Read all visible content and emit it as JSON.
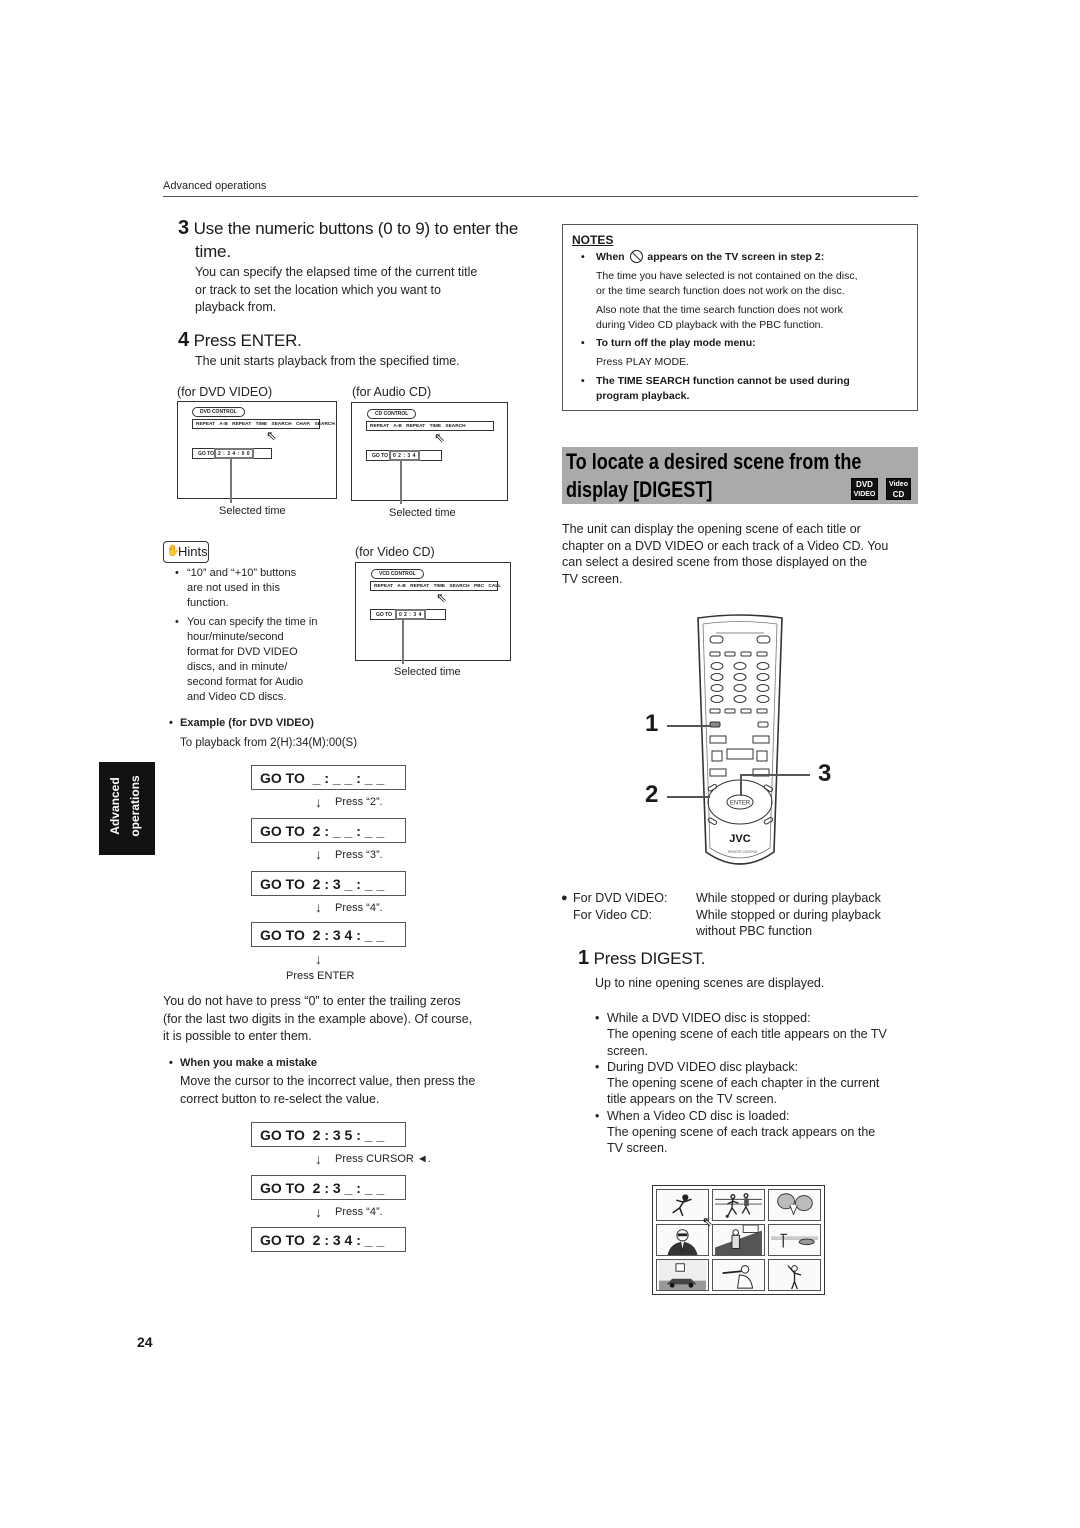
{
  "header": {
    "section": "Advanced operations"
  },
  "left": {
    "step3": {
      "num": "3",
      "title_line1": "Use the numeric buttons (0 to 9) to enter the",
      "title_line2": "time.",
      "body": [
        "You can specify the elapsed time of the current title",
        "or track to set the location which you want to",
        "playback from."
      ]
    },
    "step4": {
      "num": "4",
      "title": "Press ENTER.",
      "body": "The unit starts playback from the specified time."
    },
    "screens": {
      "dvd": {
        "caption": "(for DVD VIDEO)",
        "pill": "DVD CONTROL",
        "menu": [
          "REPEAT",
          "A-B REPEAT",
          "TIME SEARCH",
          "CHAP. SEARCH"
        ],
        "goto": "GO TO",
        "value": "2 : 3 4 : 0 0",
        "label": "Selected time"
      },
      "cd": {
        "caption": "(for Audio CD)",
        "pill": "CD CONTROL",
        "menu": [
          "REPEAT",
          "A-B REPEAT",
          "TIME SEARCH"
        ],
        "goto": "GO TO",
        "value": "0 2 : 3 4",
        "label": "Selected time"
      },
      "vcd": {
        "caption": "(for Video CD)",
        "pill": "VCD CONTROL",
        "menu": [
          "REPEAT",
          "A-B REPEAT",
          "TIME SEARCH",
          "PBC CALL"
        ],
        "goto": "GO TO",
        "value": "0 2 : 3 4",
        "label": "Selected time"
      }
    },
    "hints": {
      "title": "Hints",
      "items": [
        [
          "“10” and “+10” buttons",
          "are not used in this",
          "function."
        ],
        [
          "You can specify the time in",
          "hour/minute/second",
          "format for DVD VIDEO",
          "discs, and in minute/",
          "second format for Audio",
          "and Video CD discs."
        ]
      ]
    },
    "example": {
      "title": "Example (for DVD VIDEO)",
      "body": "To playback from 2(H):34(M):00(S)"
    },
    "sequence1": [
      {
        "display": "GO TO  _ : _ _ : _ _",
        "press": "Press “2”."
      },
      {
        "display": "GO TO  2 : _ _ : _ _",
        "press": "Press “3”."
      },
      {
        "display": "GO TO  2 : 3 _ : _ _",
        "press": "Press “4”."
      },
      {
        "display": "GO TO  2 : 3 4 : _ _",
        "press": "Press ENTER"
      }
    ],
    "trailing_note": [
      "You do not have to press “0” to enter the trailing zeros",
      "(for the last two digits in the example above). Of course,",
      "it is possible to enter them."
    ],
    "mistake": {
      "title": "When you make a mistake",
      "body": [
        "Move the cursor to the incorrect value, then press the",
        "correct button to re-select the value."
      ]
    },
    "sequence2": [
      {
        "display": "GO TO  2 : 3 5 : _ _",
        "press": "Press CURSOR ◄."
      },
      {
        "display": "GO TO  2 : 3 _ : _ _",
        "press": "Press “4”."
      },
      {
        "display": "GO TO  2 : 3 4 : _ _",
        "press": ""
      }
    ],
    "side_tab": [
      "Advanced",
      "operations"
    ],
    "page_number": "24"
  },
  "right": {
    "notes": {
      "title": "NOTES",
      "n1_title_a": "When",
      "n1_title_b": "appears on the TV screen in step 2:",
      "n1_icon": "prohibited-icon",
      "n1_body1": [
        "The time you have selected is not contained on the disc,",
        "or the time search function does not work on the disc."
      ],
      "n1_body2": [
        "Also note that the time search function does not work",
        "during Video CD playback with the PBC function."
      ],
      "n2_title": "To turn off the play mode menu:",
      "n2_body": "Press PLAY MODE.",
      "n3_title": [
        "The TIME SEARCH function cannot be used during",
        "program playback."
      ]
    },
    "section": {
      "title_line1": "To locate a desired scene from the",
      "title_line2": "display [DIGEST]",
      "badge1": [
        "DVD",
        "VIDEO"
      ],
      "badge2": [
        "Video",
        "CD"
      ]
    },
    "intro": [
      "The unit can display the opening scene of each title or",
      "chapter on a DVD VIDEO or each track of a Video CD. You",
      "can select a desired scene from those displayed on the",
      "TV screen."
    ],
    "remote": {
      "brand": "JVC",
      "subtitle": "REMOTE CONTROL",
      "callouts": [
        "1",
        "2",
        "3"
      ],
      "enter_label": "ENTER"
    },
    "conditions": [
      {
        "label": "For DVD VIDEO:",
        "value": [
          "While stopped or during playback"
        ]
      },
      {
        "label": "For Video CD:",
        "value": [
          "While stopped or during playback",
          "without PBC function"
        ]
      }
    ],
    "step1": {
      "num": "1",
      "title": "Press DIGEST.",
      "body": "Up to nine opening scenes are displayed."
    },
    "bullets": [
      {
        "lead": "While a DVD VIDEO disc is stopped:",
        "body": [
          "The opening scene of each title appears on the TV",
          "screen."
        ]
      },
      {
        "lead": "During DVD VIDEO disc playback:",
        "body": [
          "The opening scene of each chapter in the current",
          "title appears on the TV screen."
        ]
      },
      {
        "lead": "When a Video CD disc is loaded:",
        "body": [
          "The opening scene of each track appears on the",
          "TV screen."
        ]
      }
    ],
    "digest_scenes": [
      "baseball-pitcher",
      "soccer-players",
      "boxers",
      "man-in-sunglasses",
      "man-by-building",
      "beach-scene",
      "car-by-building",
      "trumpet-player",
      "person-waving"
    ]
  }
}
